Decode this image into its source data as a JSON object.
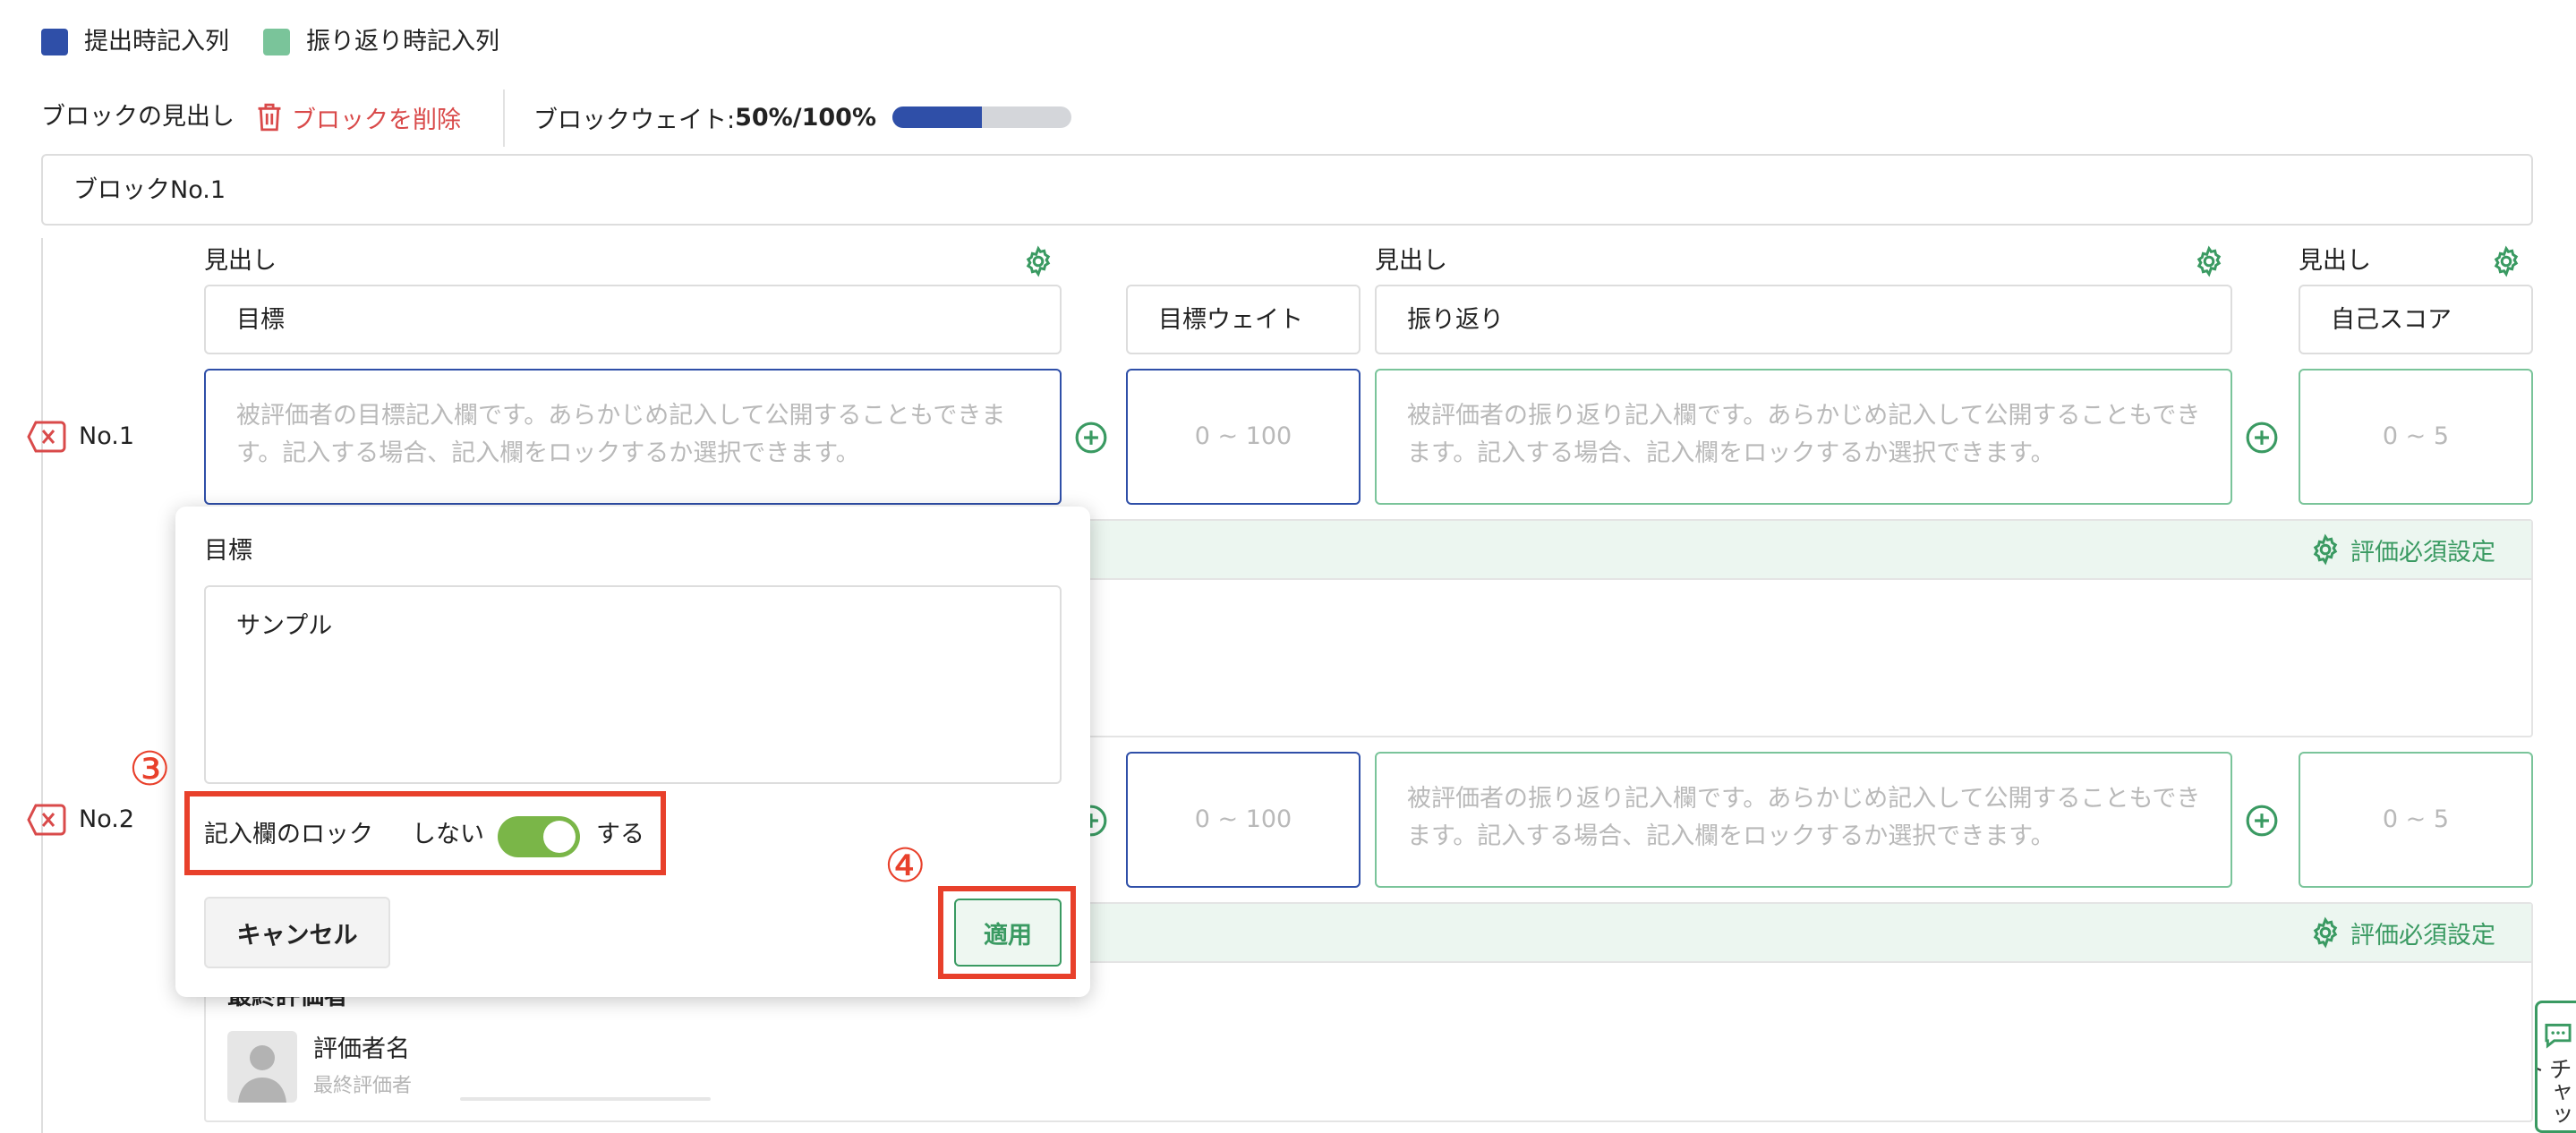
{
  "legend": {
    "submit": {
      "label": "提出時記入列",
      "color": "#2f4fa8"
    },
    "review": {
      "label": "振り返り時記入列",
      "color": "#7ac49a"
    }
  },
  "block_header": {
    "heading_label": "ブロックの見出し",
    "delete_label": "ブロックを削除",
    "weight_label": "ブロックウェイト:",
    "weight_value": "50%/100%",
    "weight_ratio": 0.5
  },
  "block_name": "ブロックNo.1",
  "columns": {
    "col1_heading": "見出し",
    "col1_value": "目標",
    "weight_header": "目標ウェイト",
    "col3_heading": "見出し",
    "col3_value": "振り返り",
    "col4_heading": "見出し",
    "col4_value": "自己スコア"
  },
  "rows": [
    {
      "label": "No.1",
      "goal_placeholder": "被評価者の目標記入欄です。あらかじめ記入して公開することもできます。記入する場合、記入欄をロックするか選択できます。",
      "weight_placeholder": "0 ~ 100",
      "review_placeholder": "被評価者の振り返り記入欄です。あらかじめ記入して公開することもできます。記入する場合、記入欄をロックするか選択できます。",
      "score_placeholder": "0 ~ 5",
      "required_setting": "評価必須設定"
    },
    {
      "label": "No.2",
      "weight_placeholder": "0 ~ 100",
      "review_placeholder": "被評価者の振り返り記入欄です。あらかじめ記入して公開することもできます。記入する場合、記入欄をロックするか選択できます。",
      "score_placeholder": "0 ~ 5",
      "required_setting": "評価必須設定"
    }
  ],
  "final_evaluator": {
    "heading": "最終評価者",
    "name": "評価者名",
    "role": "最終評価者"
  },
  "popover": {
    "title": "目標",
    "value": "サンプル",
    "lock_label": "記入欄のロック",
    "off_label": "しない",
    "on_label": "する",
    "toggle_on": true,
    "cancel_label": "キャンセル",
    "apply_label": "適用"
  },
  "annotations": {
    "step3": "③",
    "step4": "④"
  },
  "chat_tab": {
    "label": "チャット"
  },
  "colors": {
    "blue": "#2f4fa8",
    "green": "#7ac49a",
    "green_dark": "#3a9a62",
    "red": "#d94a4a",
    "highlight": "#e8402b",
    "toggle": "#7ab648"
  }
}
